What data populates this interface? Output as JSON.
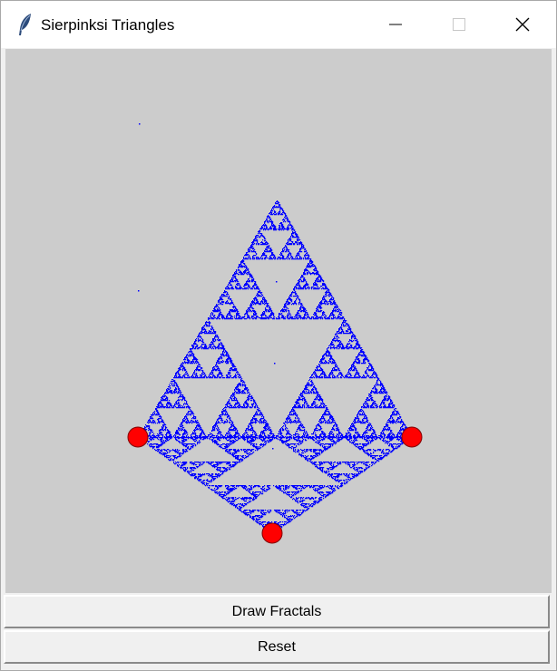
{
  "window": {
    "title": "Sierpinksi Triangles",
    "icon": "feather-icon",
    "controls": [
      "minimize-icon",
      "maximize-icon",
      "close-icon"
    ]
  },
  "canvas": {
    "background": "#cccccc",
    "point_color": "#0000ff",
    "vertex_color": "#ff0000",
    "vertex_outline": "#800000"
  },
  "buttons": {
    "draw_label": "Draw Fractals",
    "reset_label": "Reset"
  }
}
